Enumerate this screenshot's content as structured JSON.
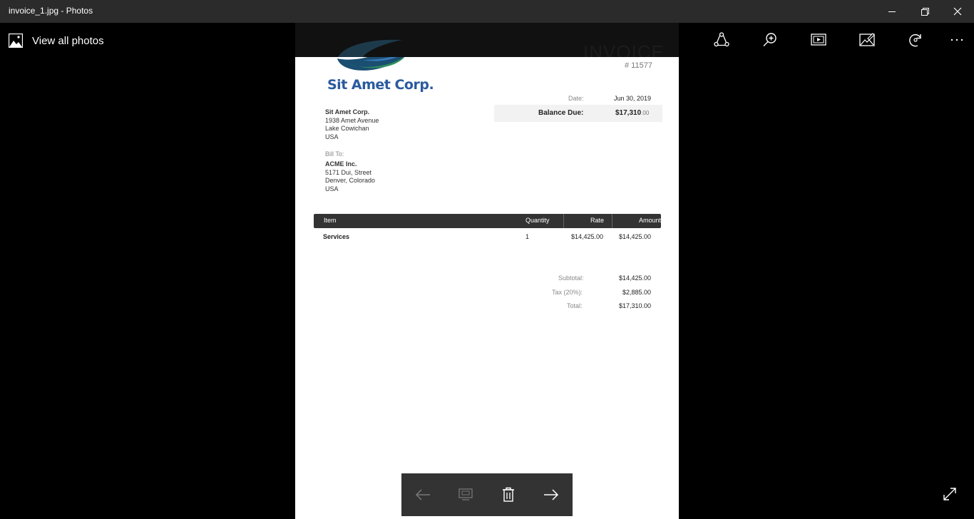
{
  "window": {
    "title": "invoice_1.jpg - Photos"
  },
  "toolbar": {
    "view_all_label": "View all photos",
    "icons": [
      "share-icon",
      "zoom-in-icon",
      "slideshow-icon",
      "edit-create-icon",
      "rotate-icon",
      "more-icon"
    ]
  },
  "invoice": {
    "heading": "INVOICE",
    "number": "# 11577",
    "company_logo_text": "Sit Amet Corp.",
    "from": {
      "name": "Sit Amet Corp.",
      "line1": "1938 Amet Avenue",
      "line2": "Lake Cowichan",
      "line3": "USA"
    },
    "bill_to_label": "Bill To:",
    "to": {
      "name": "ACME Inc.",
      "line1": "5171 Dui, Street",
      "line2": "Denver, Colorado",
      "line3": "USA"
    },
    "date_label": "Date:",
    "date_value": "Jun 30, 2019",
    "balance_label": "Balance Due:",
    "balance_main": "$17,310",
    "balance_cents": ".00",
    "table": {
      "headers": [
        "Item",
        "Quantity",
        "Rate",
        "Amount"
      ],
      "rows": [
        {
          "item": "Services",
          "quantity": "1",
          "rate": "$14,425.00",
          "amount": "$14,425.00"
        }
      ]
    },
    "totals": {
      "subtotal_label": "Subtotal:",
      "subtotal_value": "$14,425.00",
      "tax_label": "Tax (20%):",
      "tax_value": "$2,885.00",
      "total_label": "Total:",
      "total_value": "$17,310.00"
    }
  },
  "pager": {
    "icons": [
      "back-arrow-icon",
      "present-icon",
      "delete-icon",
      "forward-arrow-icon"
    ]
  }
}
